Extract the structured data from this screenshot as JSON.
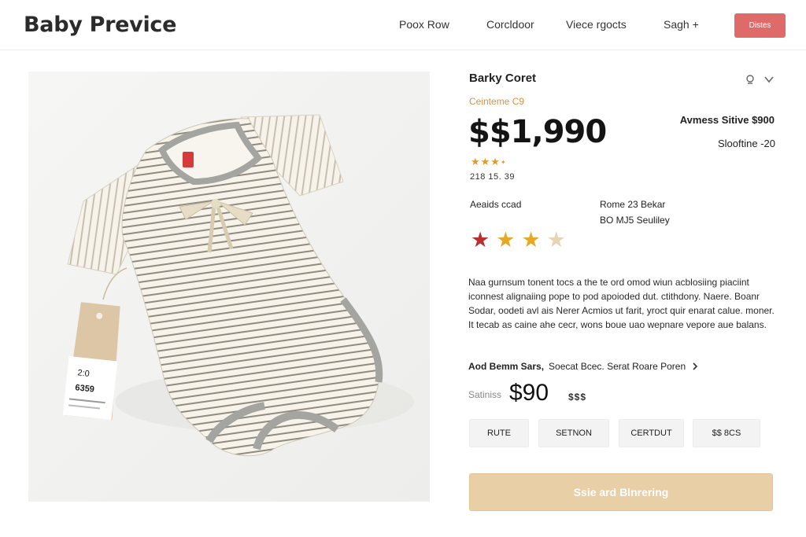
{
  "header": {
    "brand": "Baby Previce",
    "nav": [
      "Poox Row",
      "Corcldoor",
      "Viece rgocts",
      "Sagh +"
    ],
    "button_label": "Distes"
  },
  "product": {
    "image": {
      "icon": "baby-onesie-photo",
      "tag_line1": "2:0",
      "tag_line2": "6359"
    },
    "title": "Barky Coret",
    "category": "Ceinteme C9",
    "price": "$$1,990",
    "right_line_1": "Avmess Sitive $900",
    "right_line_2": "Slooftine -20",
    "small_rating_text": "218 15. 39",
    "small_rating_stars": 3,
    "left_label": "Aeaids ccad",
    "right_info_1": "Rome 23 Bekar",
    "right_info_2": "BO MJ5 Seuliley",
    "big_rating": {
      "filled": 3,
      "total": 4
    },
    "description": "Naa gurnsum tonent tocs a the te ord omod wiun acblosiing piaciint iconnest alignaiing pope to pod apoioded dut. ctithdony. Naere. Boanr Sodar, oodeti avl ais Nerer Acmios ut farit, yroct quir enarat calue. moner. It tecab as caine ahe cecr, wons boue uao wepnare vepore aue balans.",
    "link_text_bold": "Aod Bemm Sars,",
    "link_text": "Soecat Bcec. Serat Roare Poren",
    "sale_label": "Satiniss",
    "sale_price": "$90",
    "sale_suffix": "$$$",
    "options": [
      "RUTE",
      "SETNON",
      "CERTDUT",
      "$$ 8CS"
    ],
    "cta_label": "Ssie ard Blnrering"
  },
  "colors": {
    "accent_red": "#df6a6a",
    "category_orange": "#e08f3a",
    "star_red": "#b92e2e",
    "star_gold": "#e9a824",
    "star_pale": "#e6d4b3",
    "cta_beige": "#e9cfa5"
  }
}
